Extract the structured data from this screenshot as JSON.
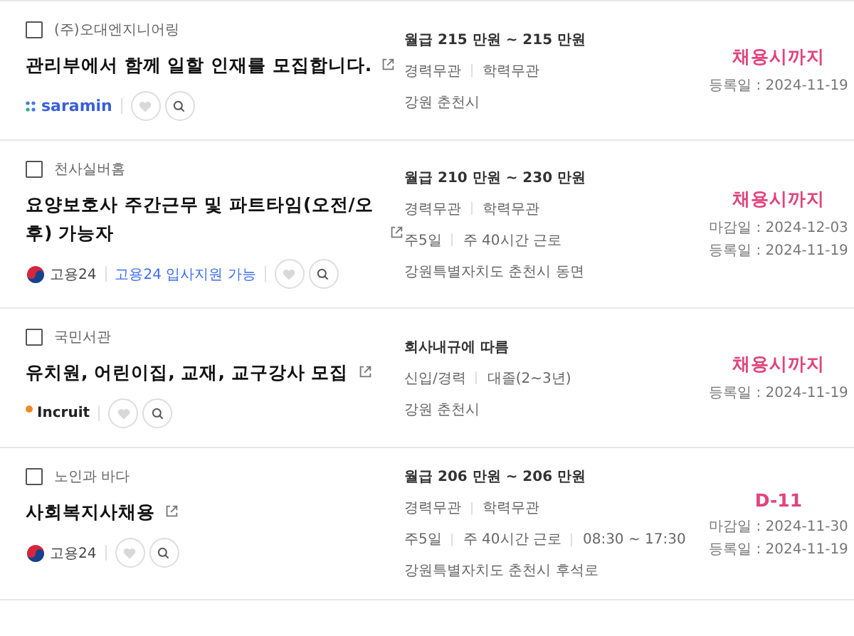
{
  "listings": [
    {
      "checked": false,
      "company": "(주)오대엔지니어링",
      "title": "관리부에서 함께 일할 인재를 모집합니다.",
      "source": {
        "kind": "saramin",
        "label": "saramin"
      },
      "salary": "월급 215 만원 ~ 215 만원",
      "info_lines": [
        [
          "경력무관",
          "학력무관"
        ]
      ],
      "location": "강원 춘천시",
      "deadline": "채용시까지",
      "dates": [
        "등록일 : 2024-11-19"
      ]
    },
    {
      "checked": false,
      "company": "천사실버홈",
      "title": "요양보호사 주간근무 및 파트타임(오전/오후) 가능자",
      "source": {
        "kind": "work24",
        "label": "고용24"
      },
      "apply_note": "고용24 입사지원 가능",
      "salary": "월급 210 만원 ~ 230 만원",
      "info_lines": [
        [
          "경력무관",
          "학력무관"
        ],
        [
          "주5일",
          "주 40시간 근로"
        ]
      ],
      "location": "강원특별자치도 춘천시 동면",
      "deadline": "채용시까지",
      "dates": [
        "마감일 : 2024-12-03",
        "등록일 : 2024-11-19"
      ]
    },
    {
      "checked": false,
      "company": "국민서관",
      "title": "유치원, 어린이집, 교재, 교구강사 모집",
      "source": {
        "kind": "incruit",
        "label": "Incruit"
      },
      "salary": "회사내규에 따름",
      "info_lines": [
        [
          "신입/경력",
          "대졸(2~3년)"
        ]
      ],
      "location": "강원 춘천시",
      "deadline": "채용시까지",
      "dates": [
        "등록일 : 2024-11-19"
      ]
    },
    {
      "checked": false,
      "company": "노인과 바다",
      "title": "사회복지사채용",
      "source": {
        "kind": "work24",
        "label": "고용24"
      },
      "salary": "월급 206 만원 ~ 206 만원",
      "info_lines": [
        [
          "경력무관",
          "학력무관"
        ],
        [
          "주5일",
          "주 40시간 근로",
          "08:30 ~ 17:30"
        ]
      ],
      "location": "강원특별자치도 춘천시 후석로",
      "deadline": "D-11",
      "dates": [
        "마감일 : 2024-11-30",
        "등록일 : 2024-11-19"
      ]
    }
  ]
}
